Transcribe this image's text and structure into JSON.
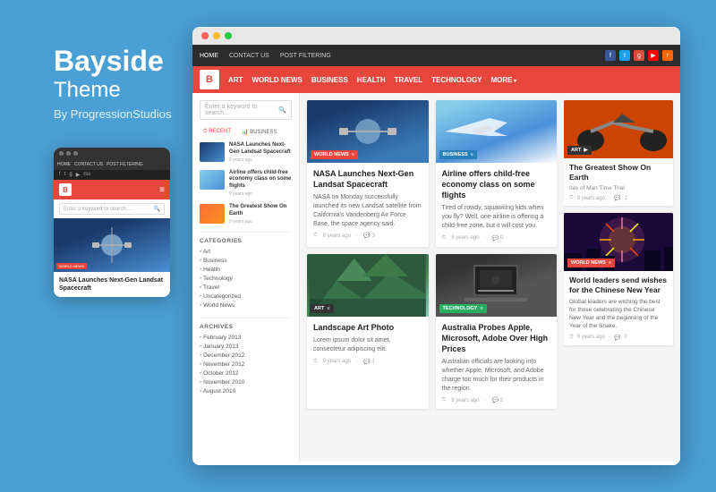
{
  "branding": {
    "title": "Bayside",
    "subtitle": "Theme",
    "by": "By ProgressionStudios"
  },
  "nav": {
    "items": [
      "HOME",
      "CONTACT US",
      "POST FILTERING"
    ],
    "social": [
      "f",
      "t",
      "g+",
      "▶",
      "rss"
    ]
  },
  "main_nav": {
    "logo": "B",
    "items": [
      "ART",
      "WORLD NEWS",
      "BUSINESS",
      "HEALTH",
      "TRAVEL",
      "TECHNOLOGY",
      "MORE"
    ]
  },
  "sidebar": {
    "search_placeholder": "Enter a keyword to search...",
    "tabs": [
      "RECENT",
      "BUSINESS"
    ],
    "posts": [
      {
        "title": "NASA Launches Next-Gen Landsat Spacecraft",
        "date": "9 years ago"
      },
      {
        "title": "Airline offers child-free economy class on some flights",
        "date": "9 years ago"
      },
      {
        "title": "The Greatest Show On Earth",
        "date": "9 years ago"
      }
    ],
    "categories_heading": "CATEGORIES",
    "categories": [
      "Art",
      "Business",
      "Health",
      "Technology",
      "Travel",
      "Uncategorized",
      "World News"
    ],
    "archives_heading": "ARCHIVES",
    "archives": [
      "February 2013",
      "January 2013",
      "December 2012",
      "November 2012",
      "October 2012",
      "November 2010",
      "August 2010"
    ]
  },
  "articles": [
    {
      "id": "nasa",
      "category": "WORLD NEWS",
      "title": "NASA Launches Next-Gen Landsat Spacecraft",
      "excerpt": "NASA on Monday successfully launched its new Landsat satellite from California's Vandenberg Air Force Base, the space agency said.",
      "date": "9 years ago",
      "comments": "3"
    },
    {
      "id": "airline",
      "category": "BUSINESS",
      "title": "Airline offers child-free economy class on some flights",
      "excerpt": "Tired of rowdy, squawking kids when you fly? Well, one airline is offering a child-free zone, but it will cost you.",
      "date": "9 years ago",
      "comments": "0"
    },
    {
      "id": "landscape",
      "category": "ART",
      "title": "Landscape Art Photo",
      "excerpt": "Lorem ipsum dolor sit amet, consectetur adipiscing elit.",
      "date": "9 years ago",
      "comments": "1"
    },
    {
      "id": "australia",
      "category": "TECHNOLOGY",
      "title": "Australia Probes Apple, Microsoft, Adobe Over High Prices",
      "excerpt": "Australian officials are looking into whether Apple, Microsoft, and Adobe charge too much for their products in the region.",
      "date": "9 years ago",
      "comments": "2"
    }
  ],
  "right_articles": [
    {
      "id": "greatest-show",
      "category": "ART",
      "title": "The Greatest Show On Earth",
      "subtitle": "Isle of Man Time Trial",
      "date": "9 years ago",
      "comments": "1"
    },
    {
      "id": "chinese-new-year",
      "category": "WORLD NEWS",
      "title": "World leaders send wishes for the Chinese New Year",
      "excerpt": "Global leaders are wishing the best for those celebrating the Chinese New Year and the beginning of the Year of the Snake.",
      "date": "9 years ago",
      "comments": "0"
    }
  ],
  "mobile": {
    "nav_items": [
      "HOME",
      "CONTACT US",
      "POST FILTERING"
    ],
    "logo": "B",
    "search_placeholder": "Enter a keyword to search...",
    "article_title": "NASA Launches Next-Gen Landsat Spacecraft",
    "badge": "WORLD NEWS"
  }
}
